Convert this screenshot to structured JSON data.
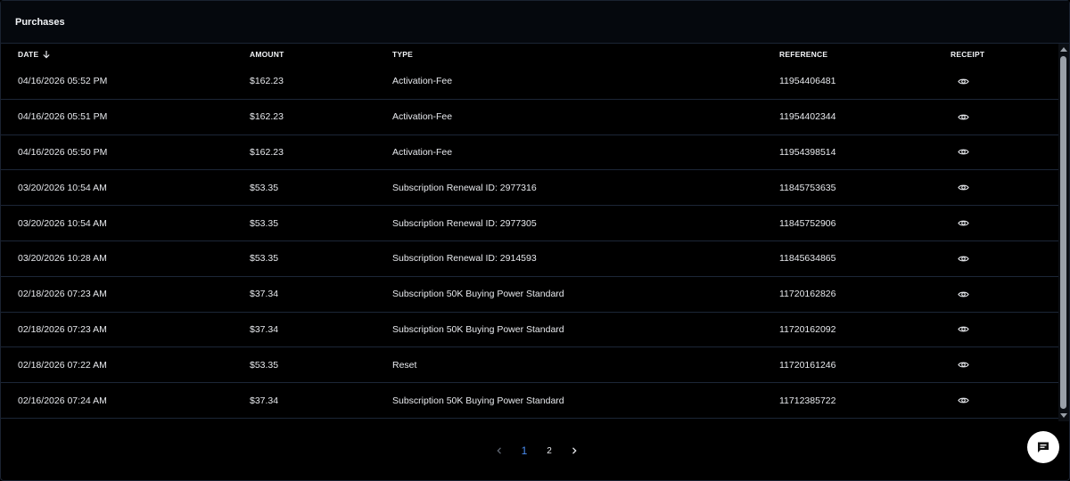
{
  "panel": {
    "title": "Purchases"
  },
  "table": {
    "headers": {
      "date": "DATE",
      "amount": "AMOUNT",
      "type": "TYPE",
      "reference": "REFERENCE",
      "receipt": "RECEIPT"
    },
    "sort": {
      "column": "date",
      "direction": "descending",
      "icon": "arrow-down-icon"
    },
    "rows": [
      {
        "date": "04/16/2026 05:52 PM",
        "amount": "$162.23",
        "type": "Activation-Fee",
        "reference": "11954406481"
      },
      {
        "date": "04/16/2026 05:51 PM",
        "amount": "$162.23",
        "type": "Activation-Fee",
        "reference": "11954402344"
      },
      {
        "date": "04/16/2026 05:50 PM",
        "amount": "$162.23",
        "type": "Activation-Fee",
        "reference": "11954398514"
      },
      {
        "date": "03/20/2026 10:54 AM",
        "amount": "$53.35",
        "type": "Subscription Renewal ID: 2977316",
        "reference": "11845753635"
      },
      {
        "date": "03/20/2026 10:54 AM",
        "amount": "$53.35",
        "type": "Subscription Renewal ID: 2977305",
        "reference": "11845752906"
      },
      {
        "date": "03/20/2026 10:28 AM",
        "amount": "$53.35",
        "type": "Subscription Renewal ID: 2914593",
        "reference": "11845634865"
      },
      {
        "date": "02/18/2026 07:23 AM",
        "amount": "$37.34",
        "type": "Subscription 50K Buying Power Standard",
        "reference": "11720162826"
      },
      {
        "date": "02/18/2026 07:23 AM",
        "amount": "$37.34",
        "type": "Subscription 50K Buying Power Standard",
        "reference": "11720162092"
      },
      {
        "date": "02/18/2026 07:22 AM",
        "amount": "$53.35",
        "type": "Reset",
        "reference": "11720161246"
      },
      {
        "date": "02/16/2026 07:24 AM",
        "amount": "$37.34",
        "type": "Subscription 50K Buying Power Standard",
        "reference": "11712385722"
      }
    ]
  },
  "pagination": {
    "pages": [
      "1",
      "2"
    ],
    "current": "1",
    "prev_icon": "chevron-left-icon",
    "next_icon": "chevron-right-icon"
  },
  "chat": {
    "icon": "chat-icon"
  },
  "colors": {
    "background": "#000000",
    "accent": "#4a8cf0",
    "divider": "#1c2637"
  }
}
